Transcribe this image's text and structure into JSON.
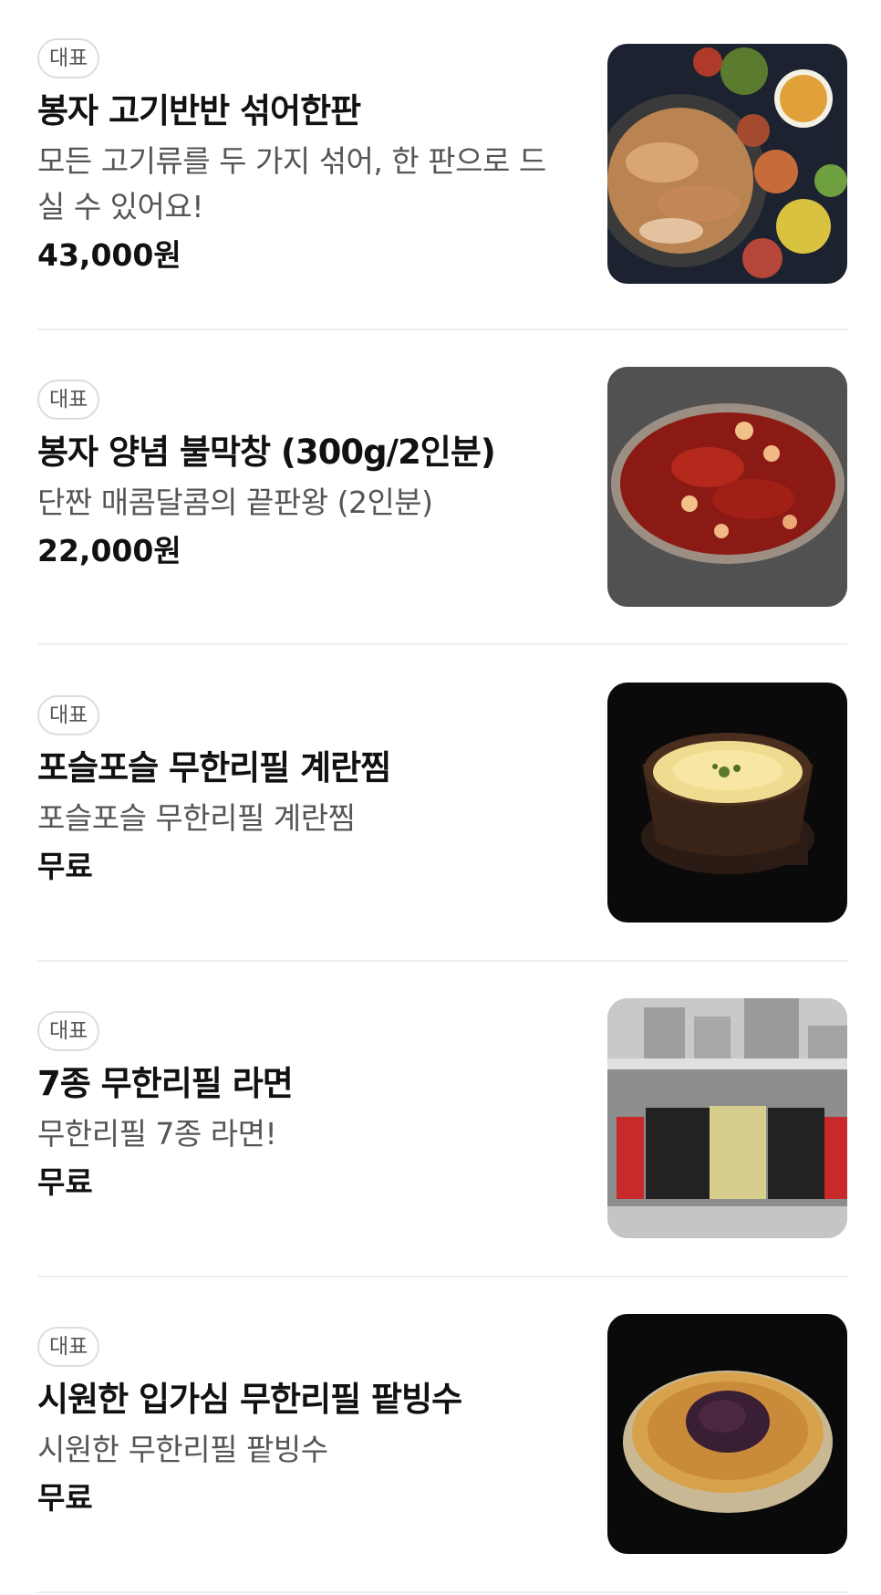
{
  "menu": {
    "items": [
      {
        "badge": "대표",
        "name": "봉자 고기반반 섞어한판",
        "desc_line1": "모든 고기류를 두 가지 섞어, 한 판으로 드",
        "desc_line2": "실 수 있어요!",
        "price": "43,000원",
        "image": "grilled-meat-platter-photo"
      },
      {
        "badge": "대표",
        "name": "봉자 양념 불막창 (300g/2인분)",
        "desc_line1": "단짠 매콤달콤의 끝판왕 (2인분)",
        "price": "22,000원",
        "image": "spicy-makchang-plate-photo"
      },
      {
        "badge": "대표",
        "name": "포슬포슬 무한리필 계란찜",
        "desc_line1": "포슬포슬 무한리필 계란찜",
        "price": "무료",
        "image": "steamed-egg-pot-photo"
      },
      {
        "badge": "대표",
        "name": "7종 무한리필 라면",
        "desc_line1": "무한리필 7종 라면!",
        "price": "무료",
        "image": "ramen-shelf-photo"
      },
      {
        "badge": "대표",
        "name": "시원한 입가심 무한리필 팥빙수",
        "desc_line1": "시원한 무한리필 팥빙수",
        "price": "무료",
        "image": "red-bean-bingsu-bowl-photo"
      }
    ]
  }
}
